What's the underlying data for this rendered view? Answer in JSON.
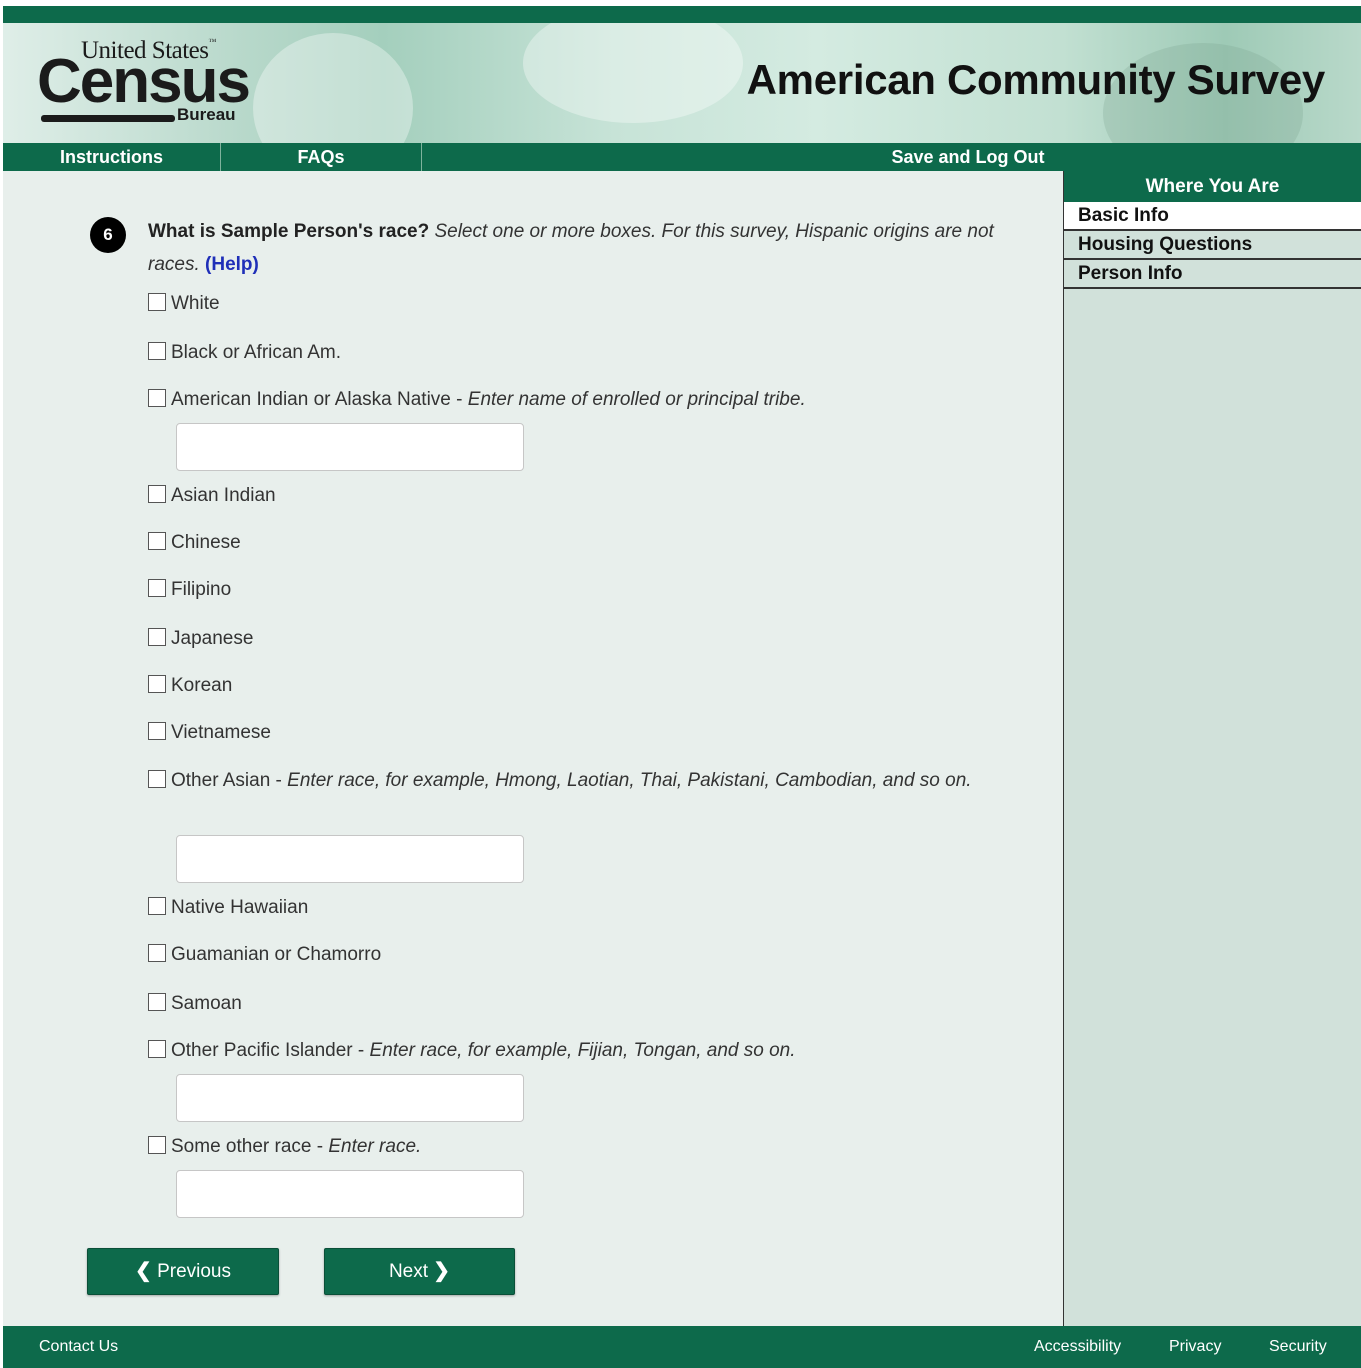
{
  "header": {
    "logo_united_states": "United States",
    "logo_census": "Census",
    "logo_bureau": "Bureau",
    "title": "American Community Survey"
  },
  "nav": {
    "instructions": "Instructions",
    "faqs": "FAQs",
    "save_logout": "Save and Log Out"
  },
  "sidebar": {
    "heading": "Where You Are",
    "items": [
      {
        "label": "Basic Info",
        "active": true
      },
      {
        "label": "Housing Questions",
        "active": false
      },
      {
        "label": "Person Info",
        "active": false
      }
    ]
  },
  "question": {
    "number": "6",
    "text_bold": "What is Sample Person's race?",
    "instruction": "Select one or more boxes. For this survey, Hispanic origins are not races.",
    "help": "(Help)"
  },
  "options": [
    {
      "label": "White",
      "checked": false
    },
    {
      "label": "Black or African Am.",
      "checked": false
    },
    {
      "label": "American Indian or Alaska Native",
      "instruction": "Enter name of enrolled or principal tribe.",
      "checked": false,
      "field_value": ""
    },
    {
      "label": "Asian Indian",
      "checked": false
    },
    {
      "label": "Chinese",
      "checked": false
    },
    {
      "label": "Filipino",
      "checked": false
    },
    {
      "label": "Japanese",
      "checked": false
    },
    {
      "label": "Korean",
      "checked": false
    },
    {
      "label": "Vietnamese",
      "checked": false
    },
    {
      "label": "Other Asian",
      "instruction": "Enter race, for example, Hmong, Laotian, Thai, Pakistani, Cambodian, and so on.",
      "checked": false,
      "field_value": ""
    },
    {
      "label": "Native Hawaiian",
      "checked": false
    },
    {
      "label": "Guamanian or Chamorro",
      "checked": false
    },
    {
      "label": "Samoan",
      "checked": false
    },
    {
      "label": "Other Pacific Islander",
      "instruction": "Enter race, for example, Fijian, Tongan, and so on.",
      "checked": false,
      "field_value": ""
    },
    {
      "label": "Some other race",
      "instruction": "Enter race.",
      "checked": false,
      "field_value": ""
    }
  ],
  "buttons": {
    "previous": "Previous",
    "next": "Next"
  },
  "footer": {
    "contact": "Contact Us",
    "accessibility": "Accessibility",
    "privacy": "Privacy",
    "security": "Security"
  },
  "colors": {
    "brand_green": "#0d6a4b",
    "content_bg": "#e8efec",
    "sidebar_bg": "#d1e1da",
    "help_link": "#1f2fb8"
  }
}
